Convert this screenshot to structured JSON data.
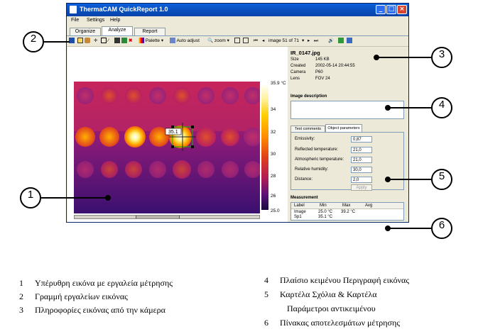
{
  "window": {
    "title": "ThermaCAM QuickReport 1.0",
    "controls": [
      "_",
      "□",
      "×"
    ],
    "menu": [
      "File",
      "Settings",
      "Help"
    ],
    "tabs": [
      "Organize",
      "Analyze",
      "Report"
    ],
    "toolbar": {
      "palette": "Palette",
      "auto_adjust": "Auto adjust",
      "zoom": "zoom",
      "image_counter": "image 51 of 71"
    }
  },
  "image": {
    "scale_max": "35.9 °C",
    "scale_min": "25.0",
    "scale_ticks": [
      "34",
      "32",
      "30",
      "28",
      "26"
    ],
    "spot_label": "35.1"
  },
  "info": {
    "filename": "IR_0147.jpg",
    "rows": [
      {
        "label": "Size",
        "value": "145 KB"
      },
      {
        "label": "Created",
        "value": "2002-05-14 20:44:55"
      },
      {
        "label": "Camera",
        "value": "P60"
      },
      {
        "label": "Lens",
        "value": "FOV 24"
      }
    ]
  },
  "description": {
    "heading": "Image description"
  },
  "params": {
    "tabs": [
      "Text comments",
      "Object parameters"
    ],
    "fields": [
      {
        "label": "Emissivity:",
        "value": "0,87"
      },
      {
        "label": "Reflected temperature:",
        "value": "21,0"
      },
      {
        "label": "Atmospheric temperature:",
        "value": "21,0"
      },
      {
        "label": "Relative humidity:",
        "value": "30,0"
      },
      {
        "label": "Distance:",
        "value": "2,0"
      }
    ],
    "apply": "Apply"
  },
  "measurement": {
    "heading": "Measurement",
    "columns": [
      "Label",
      "Min",
      "Max",
      "Avg"
    ],
    "rows": [
      [
        "Image",
        "25.0 °C",
        "39.2 °C",
        ""
      ],
      [
        "Sp1",
        "35.1 °C",
        "",
        ""
      ]
    ]
  },
  "callouts": [
    "1",
    "2",
    "3",
    "4",
    "5",
    "6"
  ],
  "legend": [
    {
      "num": "1",
      "text": "Υπέρυθρη εικόνα με εργαλεία μέτρησης"
    },
    {
      "num": "2",
      "text": "Γραμμή εργαλείων εικόνας"
    },
    {
      "num": "3",
      "text": "Πληροφορίες εικόνας από την κάμερα"
    },
    {
      "num": "4",
      "text": "Πλαίσιο κειμένου Περιγραφή εικόνας"
    },
    {
      "num": "5",
      "text": "Καρτέλα Σχόλια & Καρτέλα"
    },
    {
      "num": "",
      "text": "Παράμετροι αντικειμένου"
    },
    {
      "num": "6",
      "text": "Πίνακας αποτελεσμάτων μέτρησης"
    }
  ]
}
